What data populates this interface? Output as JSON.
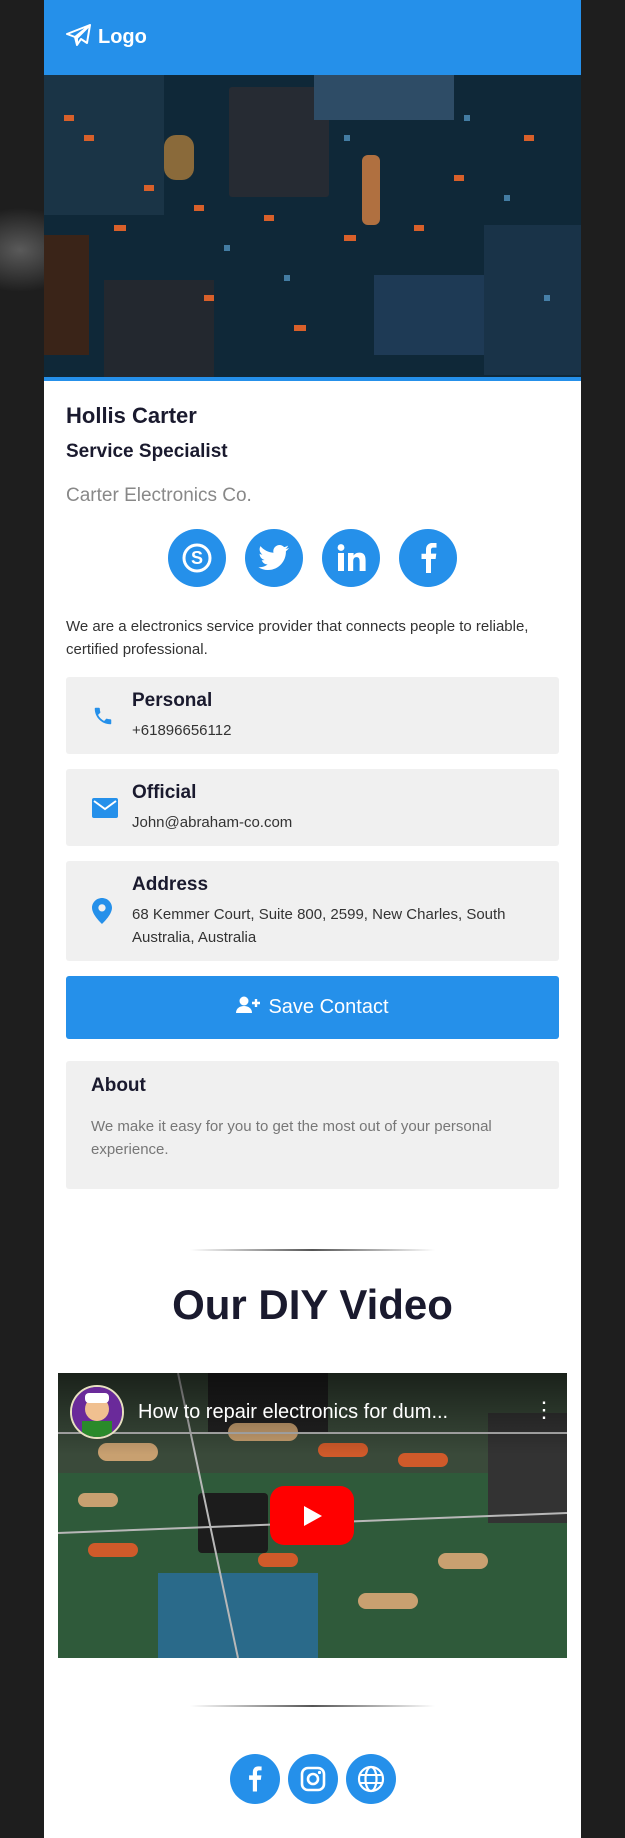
{
  "header": {
    "logo_text": "Logo",
    "brand_color": "#2590ea"
  },
  "profile": {
    "name": "Hollis Carter",
    "title": "Service Specialist",
    "company": "Carter Electronics Co.",
    "socials": [
      "skype-icon",
      "twitter-icon",
      "linkedin-icon",
      "facebook-icon"
    ],
    "description": "We are a electronics service provider that connects people to reliable, certified professional."
  },
  "contacts": [
    {
      "icon": "phone-icon",
      "title": "Personal",
      "value": "+61896656112"
    },
    {
      "icon": "mail-icon",
      "title": "Official",
      "value": "John@abraham-co.com"
    },
    {
      "icon": "location-pin-icon",
      "title": "Address",
      "value": "68 Kemmer Court, Suite 800, 2599, New Charles, South Australia, Australia"
    }
  ],
  "save_contact": {
    "label": "Save Contact",
    "icon": "add-user-icon"
  },
  "about": {
    "title": "About",
    "text": "We make it easy for you to get the most out of your personal experience."
  },
  "video_section": {
    "heading": "Our DIY Video",
    "video_title": "How to repair electronics for dum...",
    "play_icon": "youtube-play-icon"
  },
  "footer": {
    "socials": [
      "facebook-icon",
      "instagram-icon",
      "globe-icon"
    ]
  }
}
